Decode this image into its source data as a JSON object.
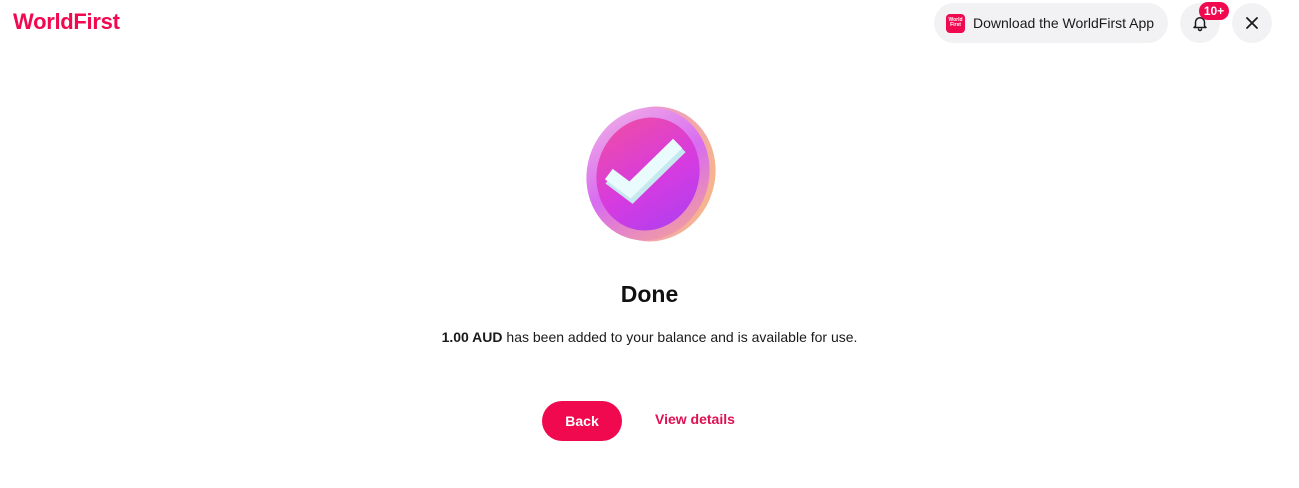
{
  "header": {
    "logo_main": "WorldFirs",
    "logo_tail": "t",
    "app_icon_text": "World First",
    "download_label": "Download the WorldFirst App",
    "notification_count": "10+"
  },
  "icons": {
    "bell": "bell-icon",
    "close": "close-icon",
    "success": "checkmark-coin-icon"
  },
  "result": {
    "title": "Done",
    "amount": "1.00 AUD",
    "message": " has been added to your balance and is available for use."
  },
  "actions": {
    "back_label": "Back",
    "view_details_label": "View details"
  },
  "colors": {
    "brand": "#f0094f",
    "pill_bg": "#f2f2f4"
  }
}
